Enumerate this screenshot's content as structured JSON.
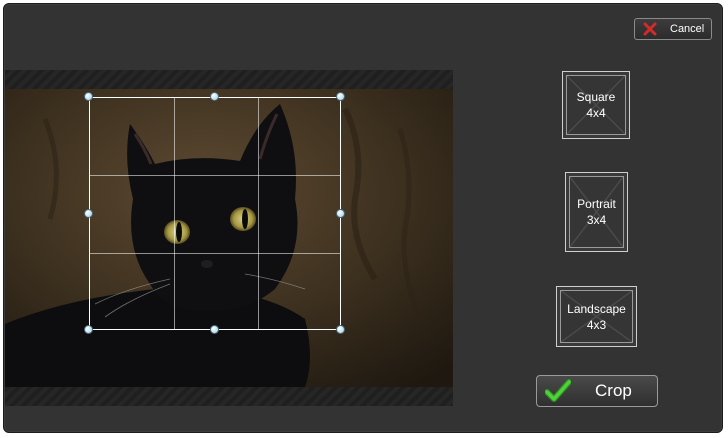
{
  "dialog": {
    "cancel_label": "Cancel"
  },
  "aspect_options": [
    {
      "label": "Square",
      "ratio": "4x4"
    },
    {
      "label": "Portrait",
      "ratio": "3x4"
    },
    {
      "label": "Landscape",
      "ratio": "4x3"
    }
  ],
  "crop_label": "Crop",
  "icons": {
    "cancel": "x-icon",
    "crop": "checkmark-icon"
  },
  "colors": {
    "cancel_x": "#d42a2a",
    "crop_check": "#3fb82f",
    "handle": "#b8dcec"
  }
}
